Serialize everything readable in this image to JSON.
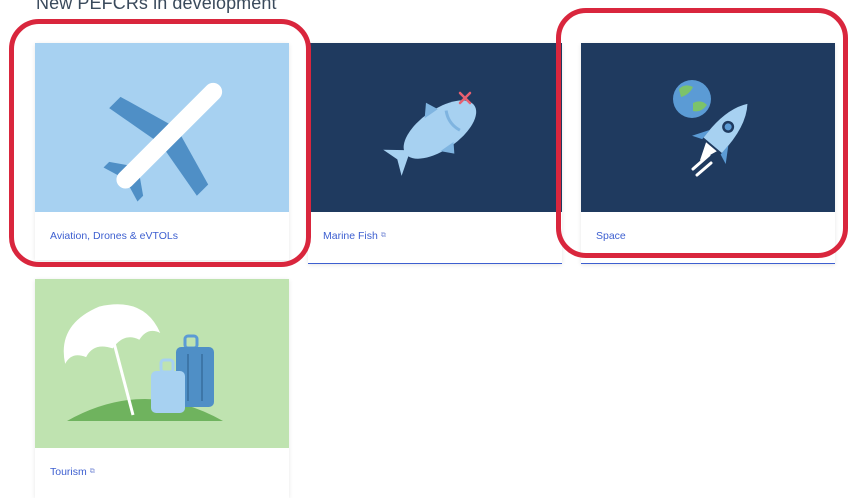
{
  "section": {
    "title": "New PEFCRs in development"
  },
  "cards": [
    {
      "label": "Aviation, Drones & eVTOLs",
      "external": "",
      "icon": "airplane-icon",
      "bg": "#a7d1f1"
    },
    {
      "label": "Marine Fish",
      "external": "⧉",
      "icon": "fish-icon",
      "bg": "#1f3a5f"
    },
    {
      "label": "Space",
      "external": "",
      "icon": "rocket-icon",
      "bg": "#1f3a5f"
    },
    {
      "label": "Tourism",
      "external": "⧉",
      "icon": "beach-luggage-icon",
      "bg": "#bfe3b0"
    }
  ],
  "colors": {
    "accent": "#3d5fd0",
    "highlight": "#d9263d"
  }
}
